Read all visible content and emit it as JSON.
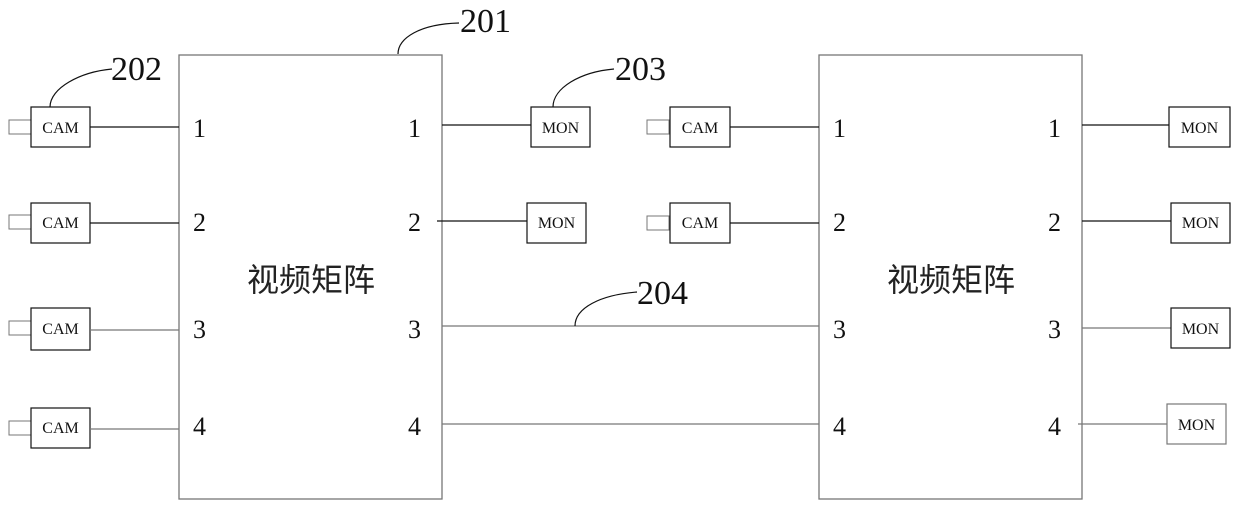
{
  "diagram": {
    "matrices": [
      {
        "id": "left",
        "title": "视频矩阵",
        "inputs": [
          "1",
          "2",
          "3",
          "4"
        ],
        "outputs": [
          "1",
          "2",
          "3",
          "4"
        ]
      },
      {
        "id": "right",
        "title": "视频矩阵",
        "inputs": [
          "1",
          "2",
          "3",
          "4"
        ],
        "outputs": [
          "1",
          "2",
          "3",
          "4"
        ]
      }
    ],
    "left_cameras": [
      "CAM",
      "CAM",
      "CAM",
      "CAM"
    ],
    "left_monitors": [
      "MON",
      "MON"
    ],
    "right_cameras": [
      "CAM",
      "CAM"
    ],
    "right_monitors": [
      "MON",
      "MON",
      "MON",
      "MON"
    ],
    "references": {
      "matrix": "201",
      "camera": "202",
      "monitor": "203",
      "link": "204"
    },
    "colors": {
      "line_dark": "#111111",
      "line_gray": "#777777"
    }
  }
}
